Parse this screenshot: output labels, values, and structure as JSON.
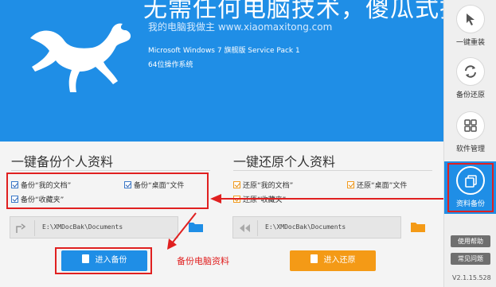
{
  "header": {
    "slogan": "无需任何电脑技术，傻瓜式操作",
    "website": "我的电脑我做主  www.xiaomaxitong.com",
    "os_name": "Microsoft Windows 7 旗舰版 Service Pack 1",
    "os_arch": "64位操作系统"
  },
  "sidebar": {
    "items": [
      {
        "label": "一键重装",
        "icon": "cursor-icon"
      },
      {
        "label": "备份还原",
        "icon": "refresh-icon"
      },
      {
        "label": "软件管理",
        "icon": "grid-icon"
      },
      {
        "label": "资料备份",
        "icon": "copy-icon",
        "active": true
      }
    ],
    "help_label": "使用帮助",
    "faq_label": "常见问题",
    "version": "V2.1.15.528"
  },
  "backup": {
    "title": "一键备份个人资料",
    "options": [
      "备份“我的文档”",
      "备份“桌面”文件",
      "备份“收藏夹”"
    ],
    "path": "E:\\XMDocBak\\Documents",
    "button_label": "进入备份"
  },
  "restore": {
    "title": "一键还原个人资料",
    "options": [
      "还原“我的文档”",
      "还原“桌面”文件",
      "还原“收藏夹”"
    ],
    "path": "E:\\XMDocBak\\Documents",
    "button_label": "进入还原"
  },
  "annotation": {
    "text": "备份电脑资料"
  },
  "colors": {
    "brand_blue": "#1f8ee6",
    "accent_orange": "#f49a16",
    "annotation_red": "#e02020"
  }
}
